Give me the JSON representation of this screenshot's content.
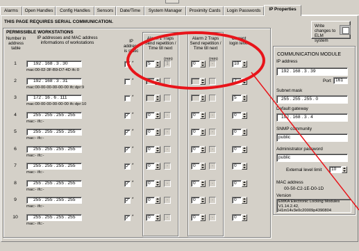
{
  "tabs": [
    {
      "label": "Alarms",
      "active": false
    },
    {
      "label": "Open Handles",
      "active": false
    },
    {
      "label": "Config Handles",
      "active": false
    },
    {
      "label": "Sensors",
      "active": false
    },
    {
      "label": "Date/Time",
      "active": false
    },
    {
      "label": "System Manager",
      "active": false
    },
    {
      "label": "Proximity Cards",
      "active": false
    },
    {
      "label": "Login Passwords",
      "active": false
    },
    {
      "label": "IP Properties",
      "active": true
    }
  ],
  "page_title": "THIS PAGE REQUIRES SERIAL COMMUNICATION.",
  "workstations": {
    "title": "PERMISSIBLE WORKSTATIONS",
    "col_number": "Number in address table",
    "col_ip": "IP addresses and MAC address informations of workstations",
    "col_static": "IP address is static",
    "col_alarm1": "Alarm 1 Traps Send repetition / Time till next",
    "col_alarm2": "Alarm 2 Traps Send repetition / Time till next",
    "col_login": "Current login level",
    "unit_min": "(min)",
    "rows": [
      {
        "no": "1",
        "ip": "192 . 168 . 3 . 30",
        "mac": "mac:00-02-3F-B9-D7-4D ifc:0",
        "static": "",
        "a1": "5",
        "a1t": "1",
        "a2": "0",
        "a2t": "-",
        "login": "10"
      },
      {
        "no": "2",
        "ip": "192 . 168 . 3 . 31",
        "mac": "mac:00-00-00-00-00-00 ifc:dpr:9",
        "static": "",
        "a1": "",
        "a1t": "",
        "a2": "",
        "a2t": "",
        "login": "7"
      },
      {
        "no": "3",
        "ip": "172 . 16 . 6 . 111",
        "mac": "mac:00-00-00-00-00-00 ifc:dpr:10",
        "static": "",
        "a1": "",
        "a1t": "",
        "a2": "",
        "a2t": "",
        "login": "5"
      },
      {
        "no": "4",
        "ip": "255 . 255 . 255 . 255",
        "mac": "mac:- ifc:-",
        "static": "✓",
        "a1": "0",
        "a1t": "-",
        "a2": "0",
        "a2t": "-",
        "login": "0"
      },
      {
        "no": "5",
        "ip": "255 . 255 . 255 . 255",
        "mac": "mac:- ifc:-",
        "static": "✓",
        "a1": "0",
        "a1t": "-",
        "a2": "0",
        "a2t": "-",
        "login": "0"
      },
      {
        "no": "6",
        "ip": "255 . 255 . 255 . 255",
        "mac": "mac:- ifc:-",
        "static": "✓",
        "a1": "0",
        "a1t": "-",
        "a2": "0",
        "a2t": "-",
        "login": "0"
      },
      {
        "no": "7",
        "ip": "255 . 255 . 255 . 255",
        "mac": "mac:- ifc:-",
        "static": "✓",
        "a1": "0",
        "a1t": "-",
        "a2": "0",
        "a2t": "-",
        "login": "0"
      },
      {
        "no": "8",
        "ip": "255 . 255 . 255 . 255",
        "mac": "mac:- ifc:-",
        "static": "✓",
        "a1": "0",
        "a1t": "-",
        "a2": "0",
        "a2t": "-",
        "login": "0"
      },
      {
        "no": "9",
        "ip": "255 . 255 . 255 . 255",
        "mac": "mac:- ifc:-",
        "static": "✓",
        "a1": "0",
        "a1t": "-",
        "a2": "0",
        "a2t": "-",
        "login": "0"
      },
      {
        "no": "10",
        "ip": "255 . 255 . 255 . 255",
        "mac": "mac:- ifc:-",
        "static": "✓",
        "a1": "0",
        "a1t": "-",
        "a2": "0",
        "a2t": "-",
        "login": "0"
      }
    ]
  },
  "write_button": "Write changes to ELM system",
  "module": {
    "title": "COMMUNICATION MODULE",
    "ip_label": "IP address",
    "ip": "192 . 168 . 3 . 39",
    "port_label": "Port",
    "port": "161",
    "subnet_label": "Subnet mask",
    "subnet": "255 . 255 . 255 . 0",
    "gateway_label": "Default gateway",
    "gateway": "192 . 168 . 3 . 4",
    "snmp_label": "SNMP community",
    "snmp": "public",
    "admin_label": "Administrator password",
    "admin": "public",
    "ext_label": "External level limit",
    "ext": "10",
    "mac_label": "MAC address",
    "mac": "00-50-C2-1E-D0-1D",
    "version_label": "Version",
    "version": "EMKA Electronic Locking Modules V1.14.2.42, H1m14v3e0c20009p4390804"
  },
  "colors": {
    "bg": "#d4d0c8",
    "annotation": "#e8141a"
  }
}
